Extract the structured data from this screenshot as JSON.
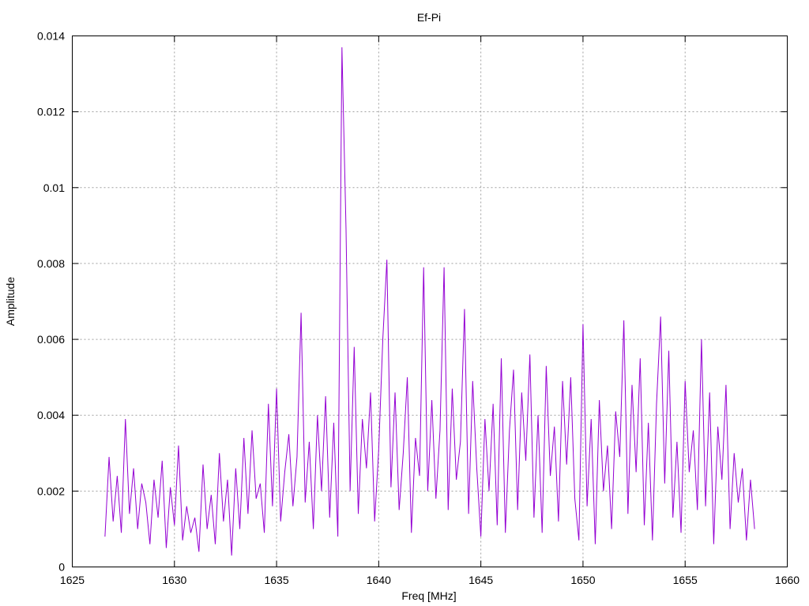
{
  "chart_data": {
    "type": "line",
    "title": "Ef-Pi",
    "xlabel": "Freq [MHz]",
    "ylabel": "Amplitude",
    "xlim": [
      1625,
      1660
    ],
    "ylim": [
      0,
      0.014
    ],
    "xticks": [
      "1625",
      "1630",
      "1635",
      "1640",
      "1645",
      "1650",
      "1655",
      "1660"
    ],
    "yticks": [
      "0",
      "0.002",
      "0.004",
      "0.006",
      "0.008",
      "0.01",
      "0.012",
      "0.014"
    ],
    "grid": true,
    "legend": "none",
    "series": [
      {
        "name": "Ef-Pi",
        "color": "#9400d3",
        "x_start": 1626.6,
        "x_step": 0.2,
        "values": [
          0.0008,
          0.0029,
          0.0012,
          0.0024,
          0.0009,
          0.0039,
          0.0014,
          0.0026,
          0.001,
          0.0022,
          0.0017,
          0.0006,
          0.0023,
          0.0013,
          0.0028,
          0.0005,
          0.0021,
          0.0011,
          0.0032,
          0.0007,
          0.0016,
          0.0009,
          0.0013,
          0.0004,
          0.0027,
          0.001,
          0.0019,
          0.0006,
          0.003,
          0.0012,
          0.0023,
          0.0003,
          0.0026,
          0.001,
          0.0034,
          0.0014,
          0.0036,
          0.0018,
          0.0022,
          0.0009,
          0.0043,
          0.0016,
          0.0047,
          0.0012,
          0.0025,
          0.0035,
          0.0016,
          0.0029,
          0.0067,
          0.0017,
          0.0033,
          0.001,
          0.004,
          0.002,
          0.0045,
          0.0013,
          0.0038,
          0.0008,
          0.0137,
          0.0089,
          0.002,
          0.0058,
          0.0014,
          0.0039,
          0.0026,
          0.0046,
          0.0012,
          0.0031,
          0.006,
          0.0081,
          0.0021,
          0.0046,
          0.0015,
          0.003,
          0.005,
          0.0009,
          0.0034,
          0.0024,
          0.0079,
          0.002,
          0.0044,
          0.0018,
          0.0036,
          0.0079,
          0.0015,
          0.0047,
          0.0023,
          0.0033,
          0.0068,
          0.0014,
          0.0049,
          0.0026,
          0.0008,
          0.0039,
          0.002,
          0.0043,
          0.0011,
          0.0055,
          0.0009,
          0.0036,
          0.0052,
          0.0015,
          0.0046,
          0.0028,
          0.0056,
          0.0013,
          0.004,
          0.0009,
          0.0053,
          0.0024,
          0.0037,
          0.0012,
          0.0049,
          0.0027,
          0.005,
          0.0018,
          0.0007,
          0.0064,
          0.0016,
          0.0039,
          0.0006,
          0.0044,
          0.002,
          0.0032,
          0.001,
          0.0041,
          0.0029,
          0.0065,
          0.0014,
          0.0048,
          0.0025,
          0.0055,
          0.0011,
          0.0038,
          0.0007,
          0.0043,
          0.0066,
          0.0022,
          0.0057,
          0.0013,
          0.0033,
          0.0009,
          0.0049,
          0.0025,
          0.0036,
          0.0015,
          0.006,
          0.0016,
          0.0046,
          0.0006,
          0.0037,
          0.0023,
          0.0048,
          0.001,
          0.003,
          0.0017,
          0.0026,
          0.0007,
          0.0023,
          0.001
        ]
      }
    ]
  }
}
